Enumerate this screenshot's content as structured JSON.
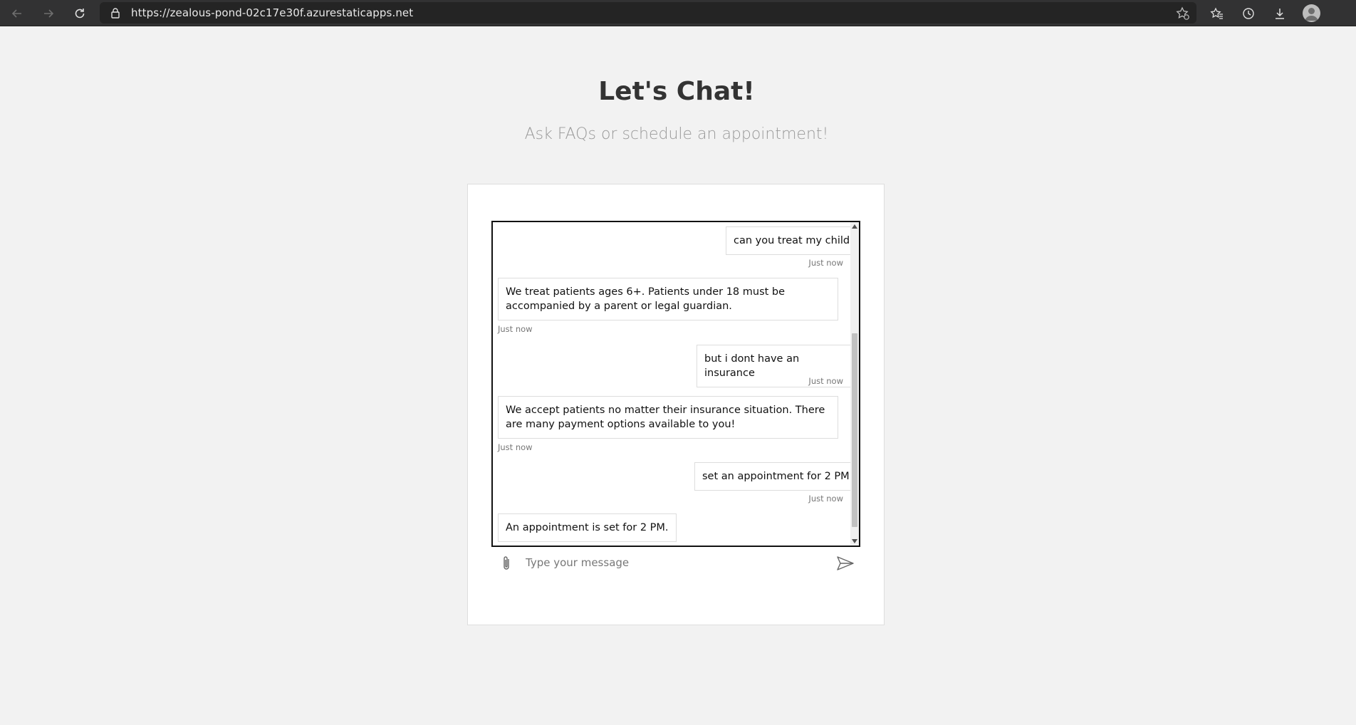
{
  "browser": {
    "url": "https://zealous-pond-02c17e30f.azurestaticapps.net",
    "icons": [
      "back-arrow-icon",
      "forward-arrow-icon",
      "reload-icon",
      "lock-icon",
      "add-favorite-icon",
      "favorites-icon",
      "history-icon",
      "download-icon",
      "profile-icon"
    ]
  },
  "page": {
    "title": "Let's Chat!",
    "subtitle": "Ask FAQs or schedule an appointment!"
  },
  "chat": {
    "messages": [
      {
        "role": "user",
        "text": "can you treat my child",
        "time": "Just now"
      },
      {
        "role": "bot",
        "text": "We treat patients ages 6+. Patients under 18 must be accompanied by a parent or legal guardian.",
        "time": "Just now"
      },
      {
        "role": "user",
        "text": "but i dont have an insurance",
        "time": "Just now"
      },
      {
        "role": "bot",
        "text": "We accept patients no matter their insurance situation. There are many payment options available to you!",
        "time": "Just now"
      },
      {
        "role": "user",
        "text": "set an appointment for 2 PM",
        "time": "Just now"
      },
      {
        "role": "bot",
        "text": "An appointment is set for 2 PM.",
        "time": ""
      }
    ],
    "input_placeholder": "Type your message",
    "input_value": ""
  },
  "colors": {
    "page_bg": "#f2f2f2",
    "chrome_bg": "#323233",
    "title": "#333333",
    "subtitle": "#999999"
  }
}
